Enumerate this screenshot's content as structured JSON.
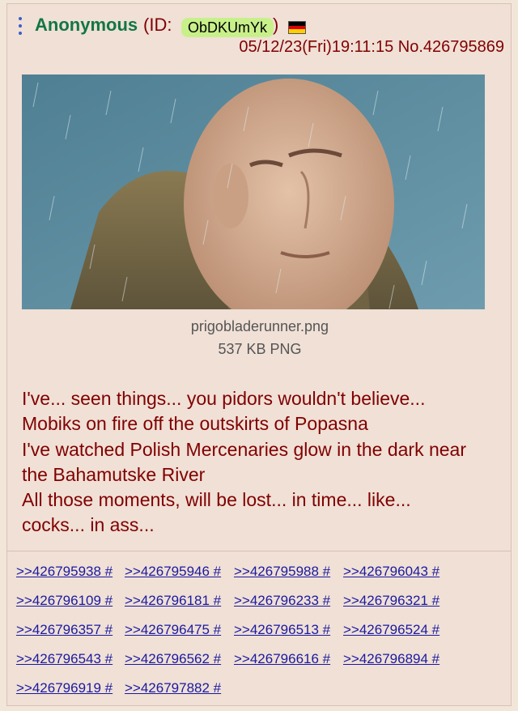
{
  "post": {
    "author": "Anonymous",
    "id_prefix": "(ID:",
    "poster_id": "ObDKUmYk",
    "id_suffix": ")",
    "flag_colors": [
      "#000000",
      "#dd0000",
      "#ffce00"
    ],
    "datetime": "05/12/23(Fri)19:11:15",
    "post_number": "No.426795869",
    "file": {
      "name": "prigobladerunner.png",
      "size": "537 KB PNG"
    },
    "body_lines": [
      "I've... seen things... you pidors wouldn't believe...",
      "Mobiks on fire off the outskirts of Popasna",
      "I've watched Polish Mercenaries glow in the dark near",
      "the Bahamutske River",
      "All those moments, will be lost... in time... like...",
      "cocks... in ass..."
    ]
  },
  "replies": [
    ">>426795938 #",
    ">>426795946 #",
    ">>426795988 #",
    ">>426796043 #",
    ">>426796109 #",
    ">>426796181 #",
    ">>426796233 #",
    ">>426796321 #",
    ">>426796357 #",
    ">>426796475 #",
    ">>426796513 #",
    ">>426796524 #",
    ">>426796543 #",
    ">>426796562 #",
    ">>426796616 #",
    ">>426796894 #",
    ">>426796919 #",
    ">>426797882 #"
  ],
  "colors": {
    "name": "#117743",
    "text": "#800000",
    "link": "#1a1aa0",
    "background": "#f0e0d6"
  }
}
